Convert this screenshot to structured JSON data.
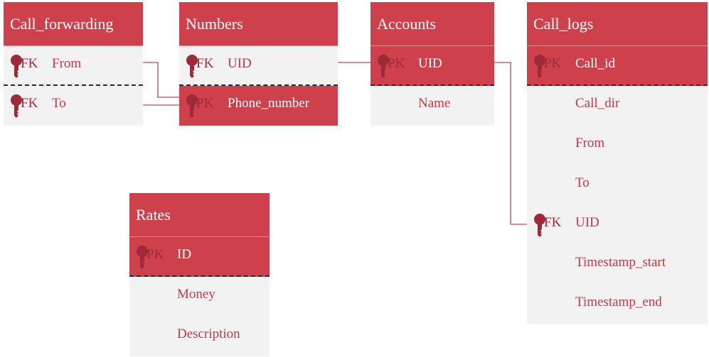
{
  "tables": [
    {
      "id": "call_forwarding",
      "name": "Call_forwarding",
      "rows": [
        {
          "key": "FK",
          "name": "From"
        },
        {
          "key": "FK",
          "name": "To"
        }
      ]
    },
    {
      "id": "numbers",
      "name": "Numbers",
      "rows": [
        {
          "key": "FK",
          "name": "UID"
        },
        {
          "key": "PK",
          "name": "Phone_number"
        }
      ]
    },
    {
      "id": "accounts",
      "name": "Accounts",
      "rows": [
        {
          "key": "PK",
          "name": "UID"
        },
        {
          "key": "",
          "name": "Name"
        }
      ]
    },
    {
      "id": "call_logs",
      "name": "Call_logs",
      "rows": [
        {
          "key": "PK",
          "name": "Call_id"
        },
        {
          "key": "",
          "name": "Call_dir"
        },
        {
          "key": "",
          "name": "From"
        },
        {
          "key": "",
          "name": "To"
        },
        {
          "key": "FK",
          "name": "UID"
        },
        {
          "key": "",
          "name": "Timestamp_start"
        },
        {
          "key": "",
          "name": "Timestamp_end"
        }
      ]
    },
    {
      "id": "rates",
      "name": "Rates",
      "rows": [
        {
          "key": "PK",
          "name": "ID"
        },
        {
          "key": "",
          "name": "Money"
        },
        {
          "key": "",
          "name": "Description"
        }
      ]
    }
  ],
  "relationships": [
    {
      "from": "Call_forwarding.From",
      "to": "Numbers.Phone_number"
    },
    {
      "from": "Call_forwarding.To",
      "to": "Numbers.Phone_number"
    },
    {
      "from": "Numbers.UID",
      "to": "Accounts.UID"
    },
    {
      "from": "Accounts.UID",
      "to": "Call_logs.UID"
    }
  ],
  "colors": {
    "header": "#cf404d",
    "row_light": "#f2f2f2",
    "text_accent": "#c03a48",
    "key_icon": "#9c2a38"
  }
}
